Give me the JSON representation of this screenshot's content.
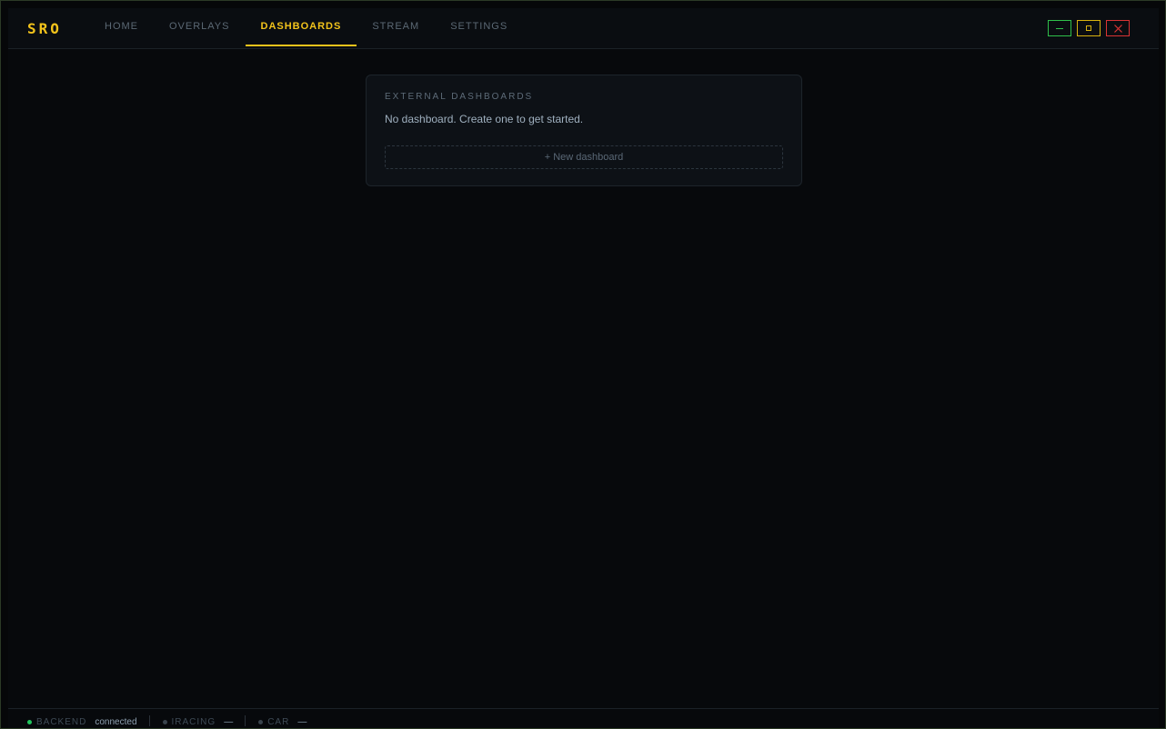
{
  "app": {
    "logo": "SRO"
  },
  "nav": {
    "tabs": [
      {
        "label": "HOME"
      },
      {
        "label": "OVERLAYS"
      },
      {
        "label": "DASHBOARDS"
      },
      {
        "label": "STREAM"
      },
      {
        "label": "SETTINGS"
      }
    ],
    "active": "DASHBOARDS"
  },
  "window_controls": {
    "close_glyph": "✕"
  },
  "card": {
    "title": "EXTERNAL DASHBOARDS",
    "empty_text": "No dashboard. Create one to get started.",
    "new_button": "+ New dashboard"
  },
  "status": {
    "items": [
      {
        "label": "BACKEND",
        "value": "connected",
        "dot_color": "#22c55e"
      },
      {
        "label": "IRACING",
        "value": "—",
        "dot_color": "#3a444d"
      },
      {
        "label": "CAR",
        "value": "—",
        "dot_color": "#3a444d"
      }
    ]
  },
  "colors": {
    "accent": "#f2c31b",
    "minimize": "#2fbf4a",
    "maximize": "#d8b20f",
    "close": "#d93434"
  }
}
